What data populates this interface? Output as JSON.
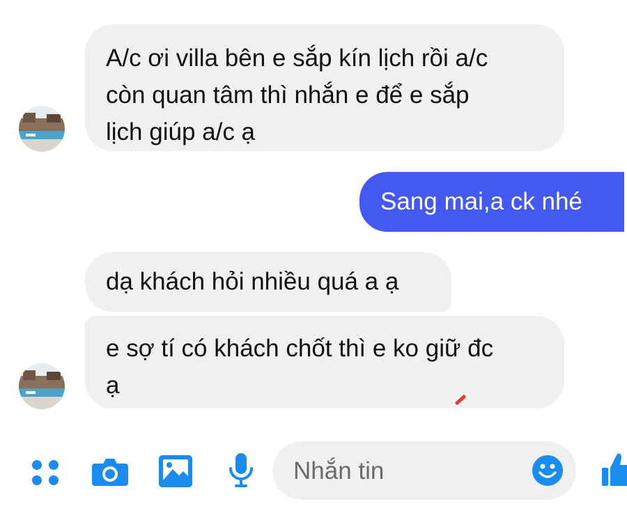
{
  "messages": {
    "incoming_1": {
      "lines": [
        "A/c ơi villa bên e sắp kín lịch rồi a/c",
        "còn quan tâm thì nhắn e để e sắp",
        "lịch giúp a/c ạ"
      ]
    },
    "outgoing_1": {
      "text": "Sang mai,a ck nhé"
    },
    "incoming_2": {
      "text": "dạ khách hỏi nhiều quá a ạ"
    },
    "incoming_3": {
      "lines": [
        "e sợ tí có khách chốt thì e ko giữ đc",
        "ạ"
      ]
    }
  },
  "composer": {
    "placeholder": "Nhắn tin",
    "icons": [
      "apps-icon",
      "camera-icon",
      "image-icon",
      "microphone-icon",
      "emoji-icon",
      "like-icon"
    ]
  },
  "colors": {
    "accent": "#4459f2",
    "icon_blue": "#1a8cf0",
    "incoming_bubble": "#f1f0f0",
    "outgoing_bubble": "#4459f2"
  }
}
